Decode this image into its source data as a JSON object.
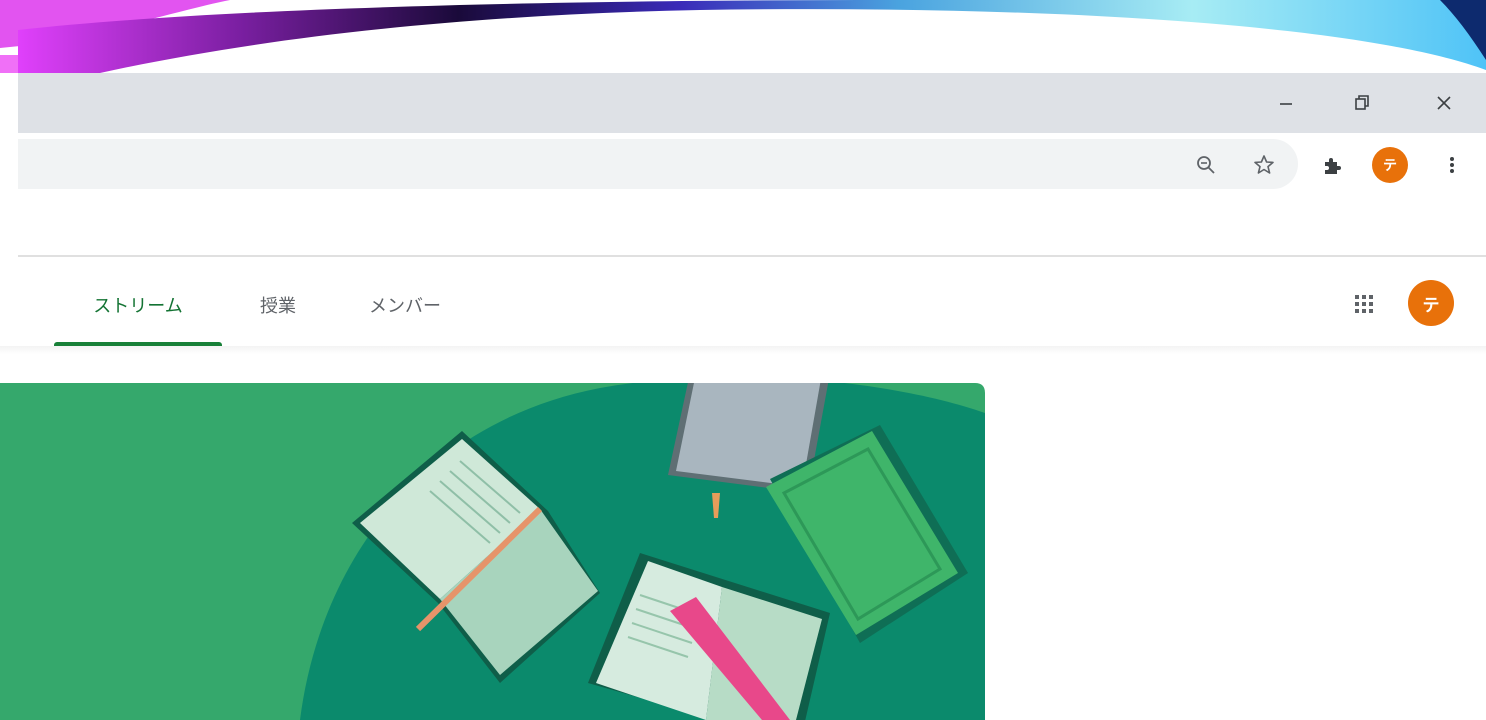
{
  "window_controls": {
    "minimize_icon": "minimize-icon",
    "restore_icon": "restore-icon",
    "close_icon": "close-icon"
  },
  "toolbar": {
    "zoom_icon": "zoom-icon",
    "bookmark_icon": "star-icon",
    "extensions_icon": "puzzle-icon",
    "profile_initial": "テ",
    "menu_icon": "more-vert-icon"
  },
  "classroom_nav": {
    "tabs": [
      {
        "label": "ストリーム",
        "active": true
      },
      {
        "label": "授業",
        "active": false
      },
      {
        "label": "メンバー",
        "active": false
      }
    ],
    "apps_icon": "apps-grid-icon",
    "account_initial": "テ"
  },
  "colors": {
    "accent_green": "#188038",
    "banner_light_green": "#34a86b",
    "banner_dark_green": "#0b8a6c",
    "avatar_orange": "#e8710a"
  }
}
